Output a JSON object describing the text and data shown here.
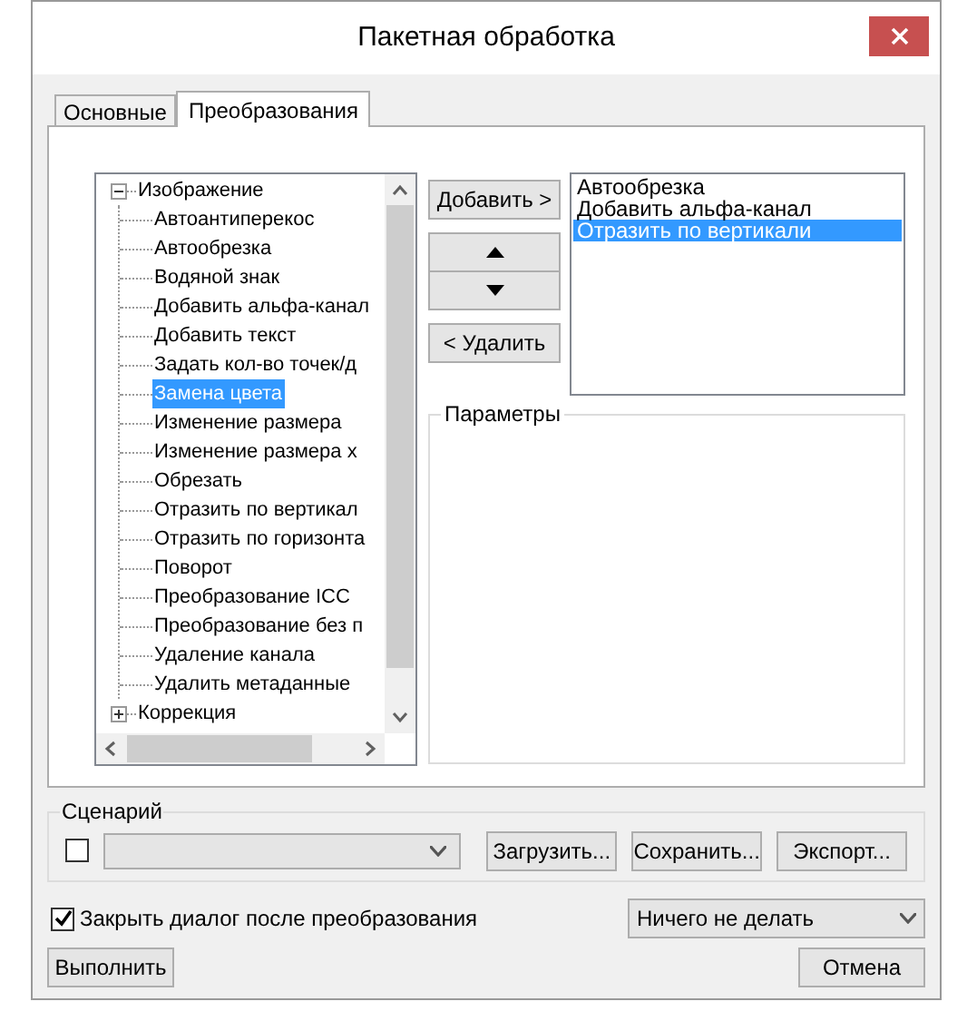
{
  "window": {
    "title": "Пакетная обработка"
  },
  "tabs": [
    {
      "label": "Основные",
      "selected": false
    },
    {
      "label": "Преобразования",
      "selected": true
    }
  ],
  "tree": [
    {
      "label": "Изображение",
      "expanded": true,
      "children": [
        {
          "label": "Автоантиперекос",
          "selected": false
        },
        {
          "label": "Автообрезка",
          "selected": false
        },
        {
          "label": "Водяной знак",
          "selected": false
        },
        {
          "label": "Добавить альфа-канал",
          "selected": false
        },
        {
          "label": "Добавить текст",
          "selected": false
        },
        {
          "label": "Задать кол-во точек/д",
          "selected": false
        },
        {
          "label": "Замена цвета",
          "selected": true
        },
        {
          "label": "Изменение размера",
          "selected": false
        },
        {
          "label": "Изменение размера х",
          "selected": false
        },
        {
          "label": "Обрезать",
          "selected": false
        },
        {
          "label": "Отразить по вертикал",
          "selected": false
        },
        {
          "label": "Отразить по горизонта",
          "selected": false
        },
        {
          "label": "Поворот",
          "selected": false
        },
        {
          "label": "Преобразование ICC",
          "selected": false
        },
        {
          "label": "Преобразование без п",
          "selected": false
        },
        {
          "label": "Удаление канала",
          "selected": false
        },
        {
          "label": "Удалить метаданные",
          "selected": false
        }
      ]
    },
    {
      "label": "Коррекция",
      "expanded": false
    }
  ],
  "add_button": "Добавить >",
  "remove_button": "< Удалить",
  "applied": [
    {
      "label": "Автообрезка",
      "selected": false
    },
    {
      "label": "Добавить альфа-канал",
      "selected": false
    },
    {
      "label": "Отразить по вертикали",
      "selected": true
    }
  ],
  "parameters": {
    "title": "Параметры"
  },
  "scenario": {
    "title": "Сценарий",
    "checked": false,
    "buttons": [
      "Загрузить...",
      "Сохранить...",
      "Экспорт..."
    ]
  },
  "close_after": {
    "label": "Закрыть диалог после преобразования",
    "checked": true
  },
  "after_action": {
    "value": "Ничего не делать"
  },
  "run_button": "Выполнить",
  "cancel_button": "Отмена"
}
